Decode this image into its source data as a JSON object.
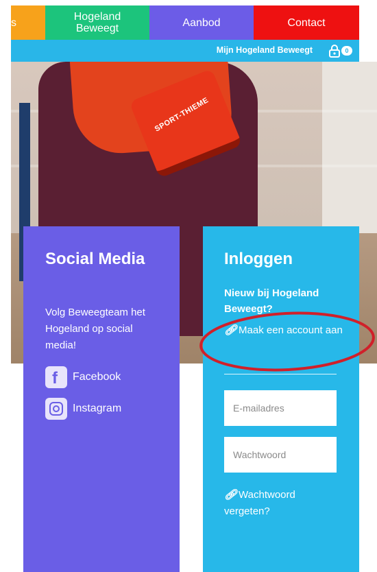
{
  "nav": {
    "partial_label": "s",
    "hogeland_label": "Hogeland Beweegt",
    "aanbod_label": "Aanbod",
    "contact_label": "Contact",
    "colors": {
      "orange": "#f7a21b",
      "green": "#1cc47c",
      "purple": "#6c5ce7",
      "red": "#ee1111"
    }
  },
  "subbar": {
    "account_link": "Mijn Hogeland Beweegt",
    "cart_count": "0",
    "icon": "lock-icon",
    "color": "#29b6e8"
  },
  "hero": {
    "glove_text": "SPORT-THIEME"
  },
  "social": {
    "title": "Social Media",
    "text": "Volg Beweegteam het Hogeland op social media!",
    "facebook_label": "Facebook",
    "instagram_label": "Instagram",
    "facebook_icon": "facebook-icon",
    "instagram_icon": "instagram-icon",
    "color": "#6a5ee6"
  },
  "login": {
    "title": "Inloggen",
    "new_text": "Nieuw bij Hogeland Beweegt?",
    "create_account_link": "Maak een account aan",
    "email_placeholder": "E-mailadres",
    "password_placeholder": "Wachtwoord",
    "forgot_link": "Wachtwoord vergeten?",
    "link_icon": "link-icon",
    "color": "#27b8e9"
  },
  "annotation": {
    "circle_color": "#d0202a"
  }
}
